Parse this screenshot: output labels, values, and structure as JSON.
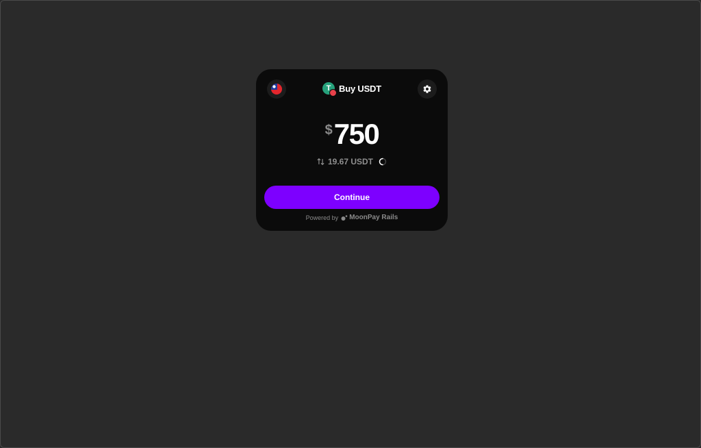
{
  "widget": {
    "title": "Buy USDT",
    "token_icon": "tether-icon",
    "token_letter": "T",
    "flag_icon": "flag-icon",
    "settings_icon": "gear-icon",
    "currency_symbol": "$",
    "amount": "750",
    "conversion_amount": "19.67 USDT",
    "continue_label": "Continue",
    "powered_by_label": "Powered by",
    "provider_name": "MoonPay Rails"
  },
  "colors": {
    "background": "#2a2a2a",
    "card": "#0b0b0b",
    "accent": "#7d00ff",
    "token": "#26a17b",
    "badge": "#e8414a"
  }
}
